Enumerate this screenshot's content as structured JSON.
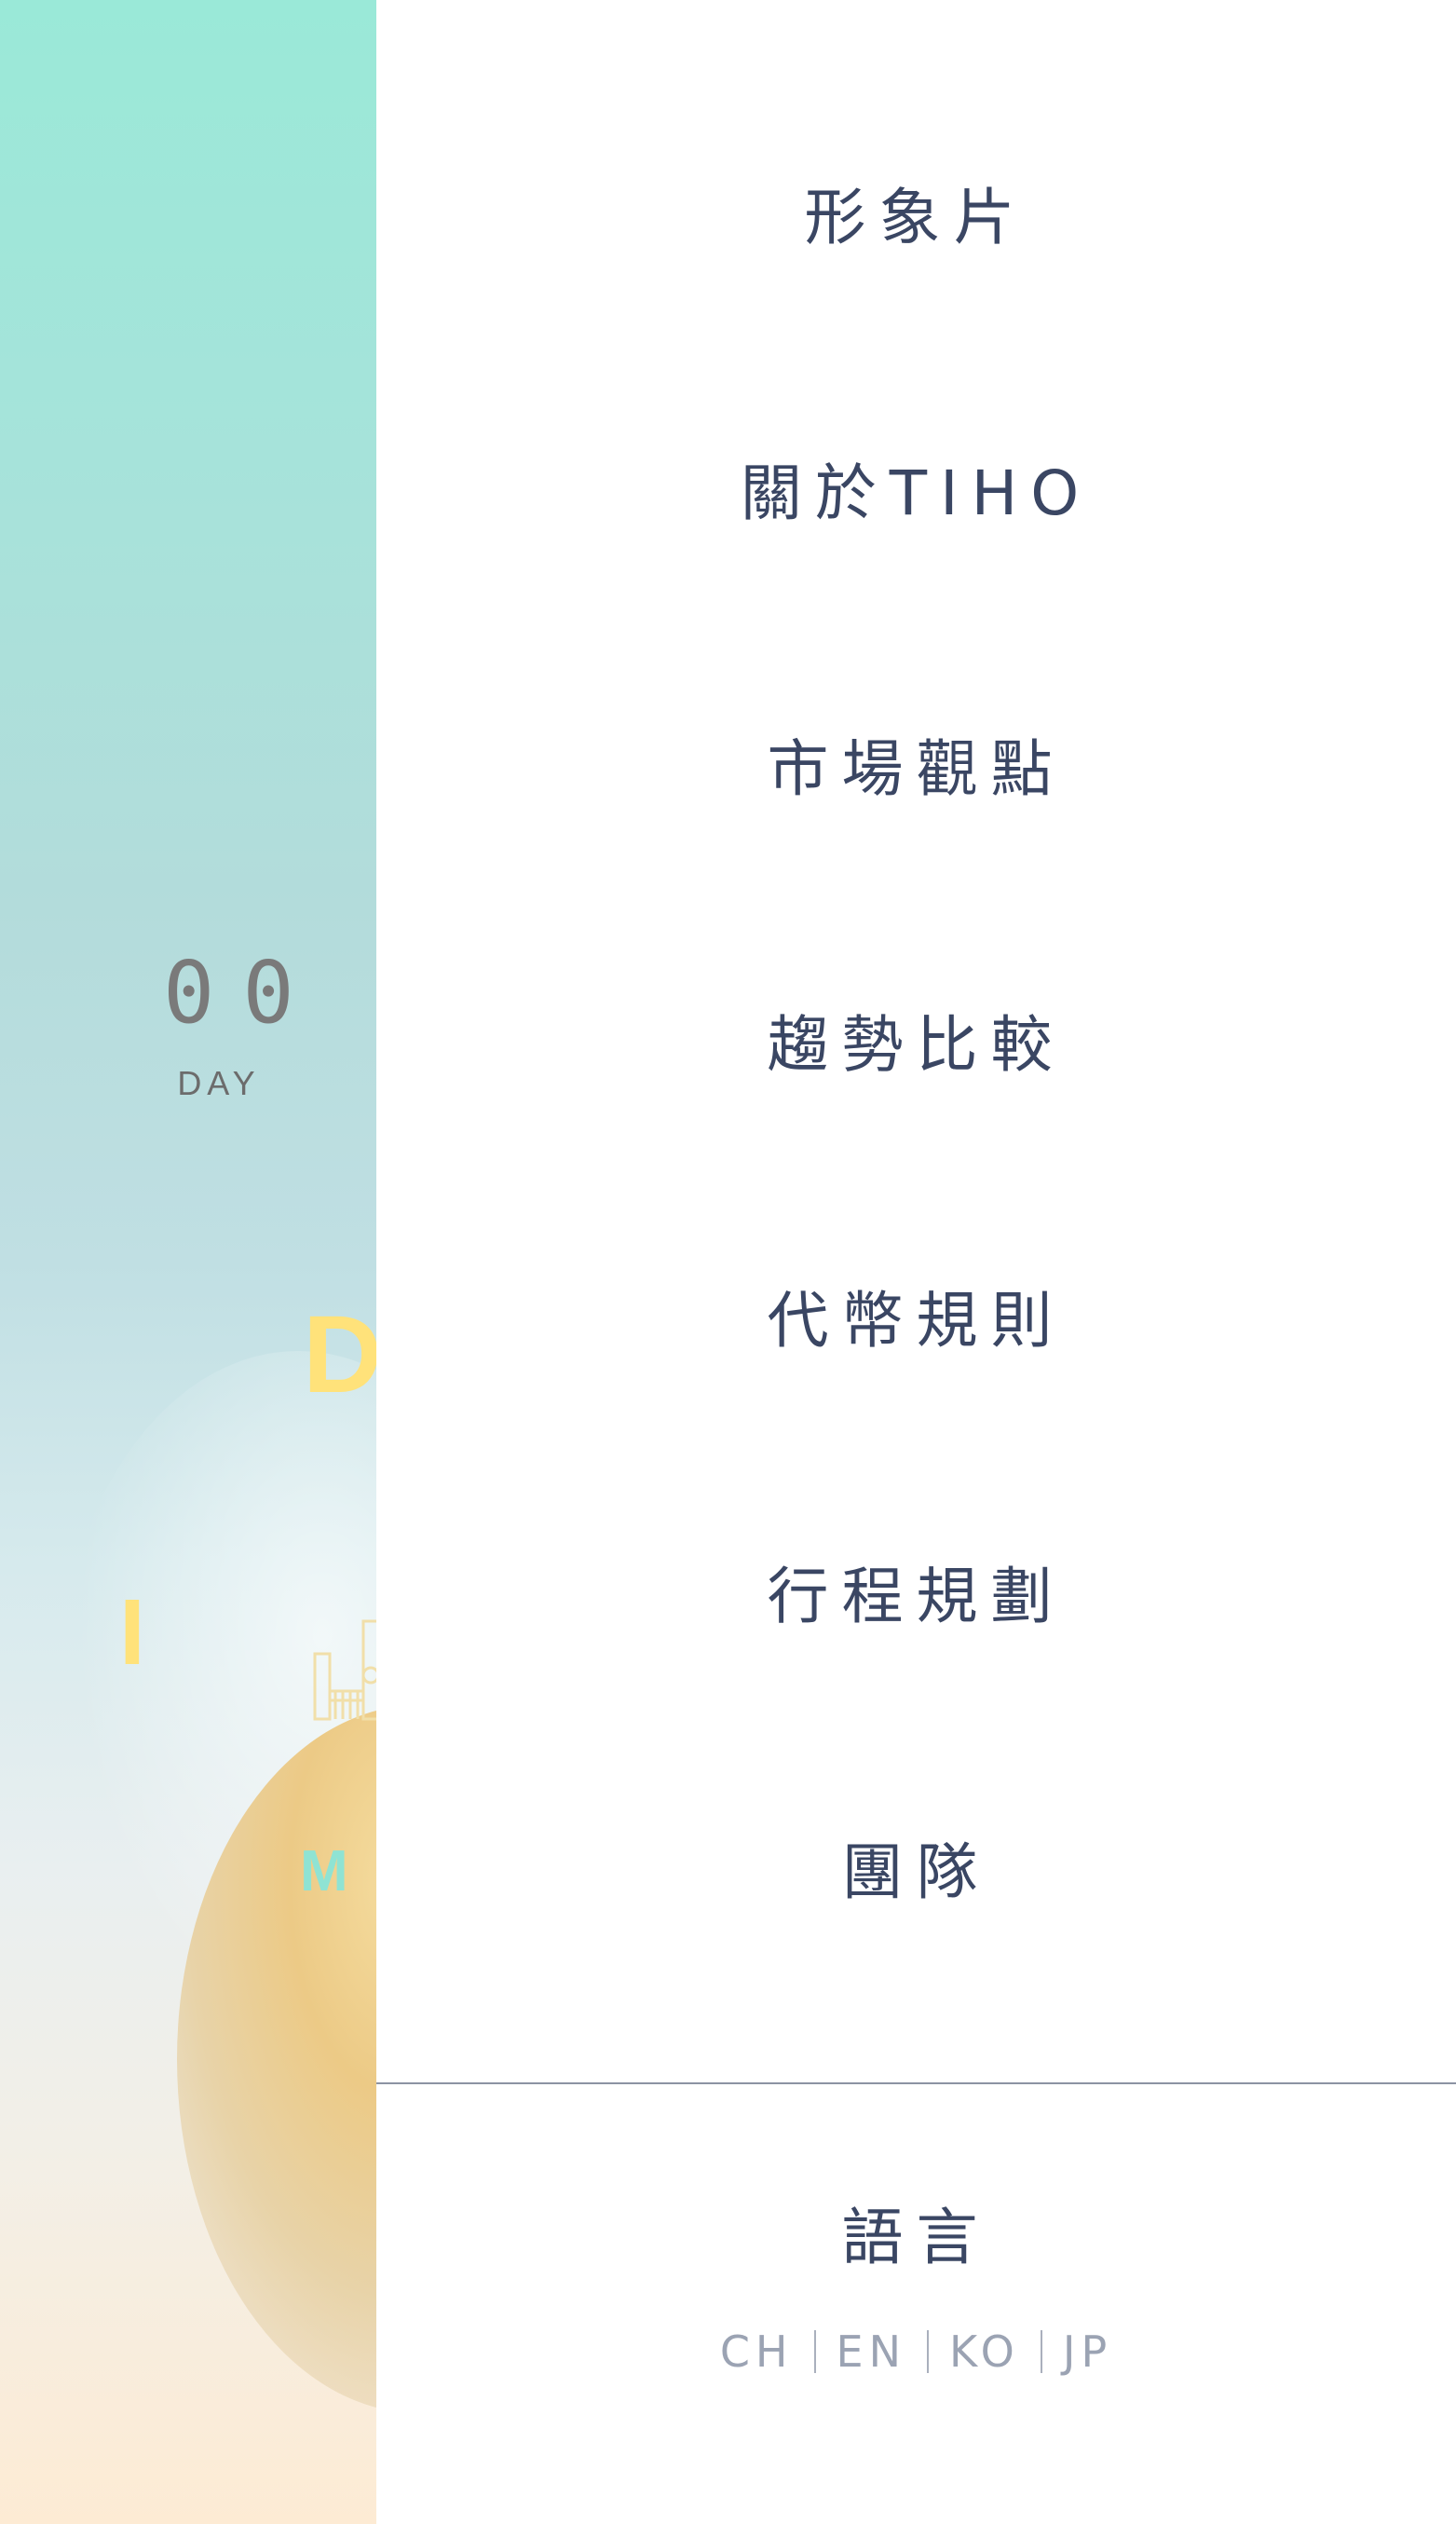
{
  "countdown": {
    "digits": "00",
    "unit": "DAY"
  },
  "decorations": {
    "letter_d": "D",
    "letter_i": "I",
    "letter_m": "M"
  },
  "menu": {
    "items": [
      {
        "label": "形象片"
      },
      {
        "label": "關於TIHO"
      },
      {
        "label": "市場觀點"
      },
      {
        "label": "趨勢比較"
      },
      {
        "label": "代幣規則"
      },
      {
        "label": "行程規劃"
      },
      {
        "label": "團隊"
      }
    ]
  },
  "language": {
    "title": "語言",
    "options": [
      "CH",
      "EN",
      "KO",
      "JP"
    ]
  },
  "colors": {
    "menu_text": "#3a4663",
    "lang_text": "#9ba3b3",
    "accent_yellow": "#ffe27a",
    "accent_teal": "#8fe3d3"
  }
}
